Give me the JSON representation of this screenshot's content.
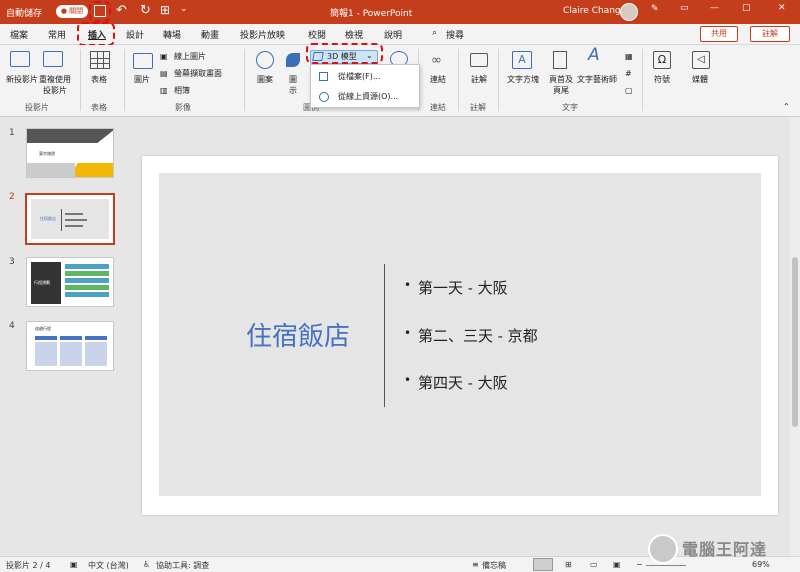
{
  "titlebar": {
    "autosave_label": "自動儲存",
    "autosave_state": "● 關閉",
    "doc_title": "簡報1 - PowerPoint",
    "user": "Claire Chang"
  },
  "tabs": [
    "檔案",
    "常用",
    "插入",
    "設計",
    "轉場",
    "動畫",
    "投影片放映",
    "校閱",
    "檢視",
    "說明",
    "搜尋"
  ],
  "share_label": "共用",
  "comment_label": "註解",
  "ribbon": {
    "new_slide": "新投影片",
    "reuse_slide": "重複使用投影片",
    "table": "表格",
    "picture": "圖片",
    "online_picture": "線上圖片",
    "screenshot": "螢幕擷取畫面",
    "album": "相簿",
    "shapes": "圖案",
    "icons": "圖示",
    "3d_models": "3D 模型",
    "link": "連結",
    "comment": "註解",
    "textbox": "文字方塊",
    "header_footer": "頁首及頁尾",
    "wordart": "文字藝術師",
    "symbols": "符號",
    "media": "媒體",
    "groups": {
      "slides": "投影片",
      "tables": "表格",
      "images": "影像",
      "illustrations": "圖例",
      "links": "連結",
      "comments": "註解",
      "text": "文字"
    }
  },
  "dropdown": {
    "from_file": "從檔案(F)...",
    "from_online": "從線上資源(O)..."
  },
  "thumbnails": [
    {
      "num": "1",
      "title": "東京旅遊"
    },
    {
      "num": "2",
      "title": "住宿飯店"
    },
    {
      "num": "3",
      "title": "行程規劃"
    },
    {
      "num": "4",
      "title": "這趟行程"
    }
  ],
  "slide": {
    "title": "住宿飯店",
    "bullets": [
      "第一天 - 大阪",
      "第二、三天 - 京都",
      "第四天 - 大阪"
    ]
  },
  "status": {
    "slide_info": "投影片 2 / 4",
    "language": "中文 (台灣)",
    "accessibility": "協助工具: 調查",
    "notes": "備忘稿",
    "zoom": "69%"
  },
  "colors": {
    "accent": "#c43e1c",
    "title_blue": "#4472c4",
    "highlight": "#e01010"
  }
}
